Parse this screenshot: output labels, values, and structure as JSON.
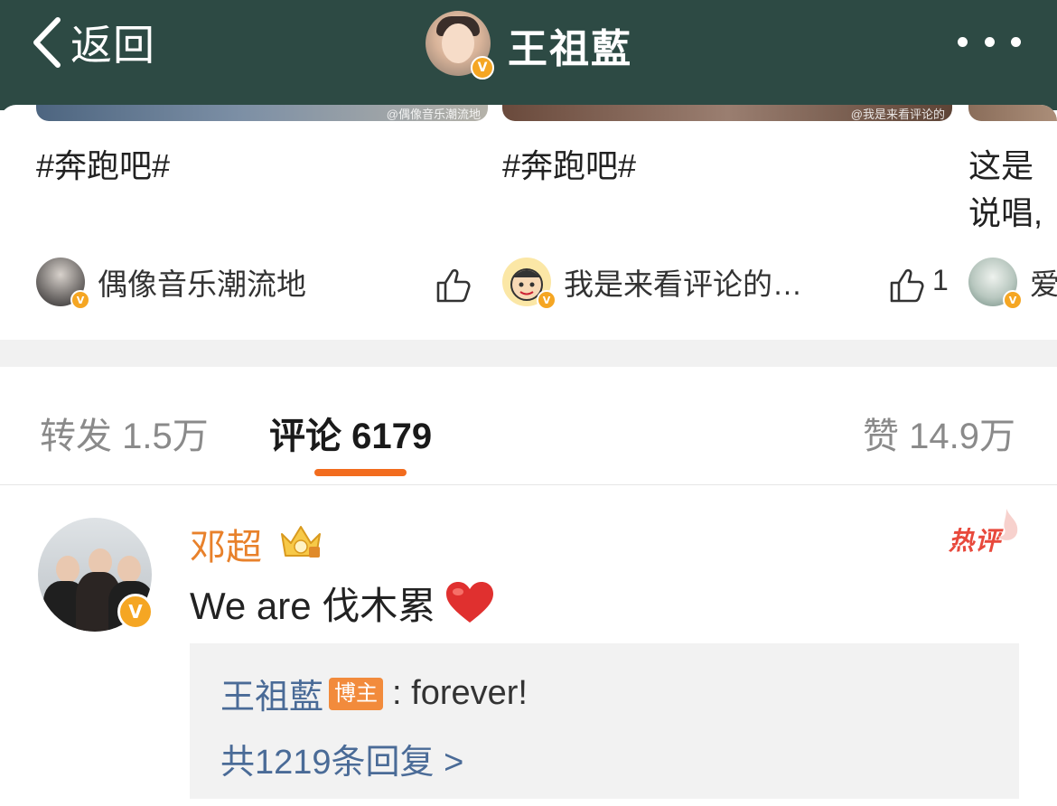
{
  "header": {
    "back_label": "返回",
    "title": "王祖藍"
  },
  "cards": [
    {
      "text": "#奔跑吧#",
      "watermark": "@偶像音乐潮流地",
      "author": "偶像音乐潮流地",
      "likes": ""
    },
    {
      "text": "#奔跑吧#",
      "watermark": "@我是来看评论的",
      "author": "我是来看评论的…",
      "likes": "1"
    },
    {
      "text_line1": "这是",
      "text_line2": "说唱,",
      "author": "爱"
    }
  ],
  "tabs": {
    "repost": "转发 1.5万",
    "comment": "评论 6179",
    "like": "赞 14.9万"
  },
  "comment": {
    "user": "邓超",
    "hot_label": "热评",
    "text": "We are 伐木累",
    "reply": {
      "user": "王祖藍",
      "author_tag": "博主",
      "text": ": forever!",
      "more": "共1219条回复 >"
    }
  },
  "colors": {
    "header_bg": "#2d4a44",
    "accent": "#f26c1e",
    "username": "#e8812b",
    "link": "#4a6b97",
    "verified_badge": "#f5a623"
  }
}
